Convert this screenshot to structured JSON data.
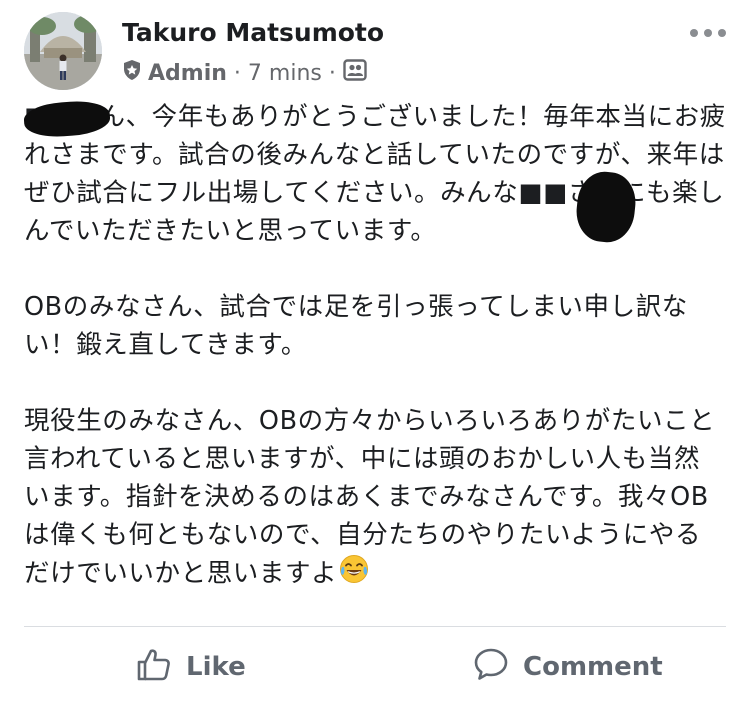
{
  "post": {
    "author": "Takuro Matsumoto",
    "role": "Admin",
    "separator": "·",
    "timestamp": "7 mins",
    "audience_icon": "group-icon",
    "badge_icon": "admin-shield-icon",
    "paragraphs": [
      "■■さん、今年もありがとうございました！毎年本当にお疲れさまです。試合の後みんなと話していたのですが、来年はぜひ試合にフル出場してください。みんな■■さんにも楽しんでいただきたいと思っています。",
      "OBのみなさん、試合では足を引っ張ってしまい申し訳ない！鍛え直してきます。",
      "現役生のみなさん、OBの方々からいろいろありがたいこと言われていると思いますが、中には頭のおかしい人も当然います。指針を決めるのはあくまでみなさんです。我々OBは偉くも何ともないので、自分たちのやりたいようにやるだけでいいかと思いますよ"
    ],
    "trailing_emoji": "laughing-with-tears-emoji"
  },
  "actions": {
    "like_label": "Like",
    "comment_label": "Comment"
  },
  "colors": {
    "text": "#1c1e21",
    "meta": "#65676b",
    "action": "#606770",
    "divider": "#dadde1"
  }
}
